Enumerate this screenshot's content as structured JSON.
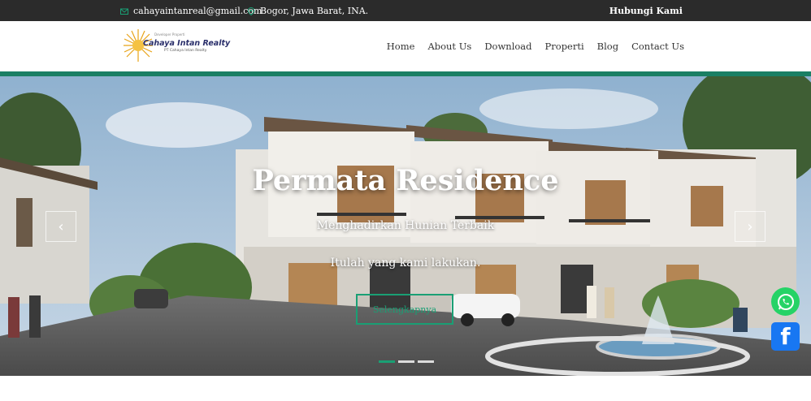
{
  "topbar": {
    "email": "cahayaintanreal@gmail.com",
    "location": "Bogor, Jawa Barat, INA.",
    "hubungi": "Hubungi Kami"
  },
  "logo": {
    "brand": "Cahaya Intan Realty",
    "tagline": "PT Cahaya Intan Realty",
    "toptag": "Developer Properti"
  },
  "nav": {
    "items": [
      "Home",
      "About Us",
      "Download",
      "Properti",
      "Blog",
      "Contact Us"
    ]
  },
  "hero": {
    "title": "Permata Residence",
    "subtitle": "Menghadirkan Hunian Terbaik",
    "subtitle2": "Itulah yang kami lakukan.",
    "cta": "Selengkapnya",
    "prev": "‹",
    "next": "›",
    "slides": 3,
    "active_slide": 1
  },
  "colors": {
    "accent": "#1a9f74",
    "topbar": "#2b2b2b",
    "green_line": "#1a7f64"
  },
  "icons": {
    "email": "envelope-icon",
    "location": "map-pin-icon",
    "whatsapp": "whatsapp-icon",
    "facebook": "facebook-icon"
  }
}
